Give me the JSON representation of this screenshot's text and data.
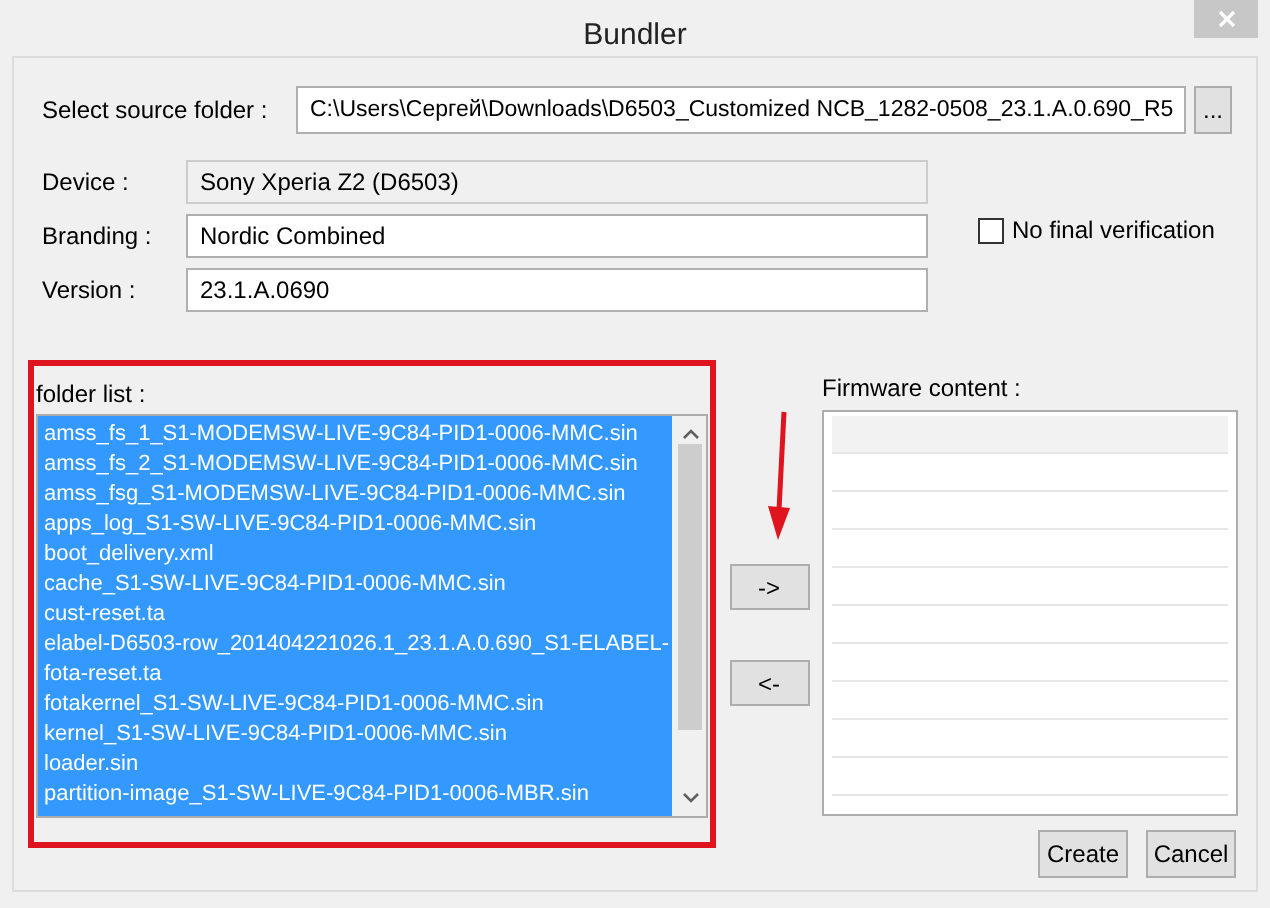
{
  "window": {
    "title": "Bundler"
  },
  "source_folder": {
    "label": "Select source folder :",
    "value": "C:\\Users\\Сергей\\Downloads\\D6503_Customized NCB_1282-0508_23.1.A.0.690_R5",
    "browse_button": "..."
  },
  "fields": [
    {
      "label": "Device :",
      "value": "Sony Xperia Z2 (D6503)",
      "disabled": true
    },
    {
      "label": "Branding :",
      "value": "Nordic Combined",
      "disabled": false
    },
    {
      "label": "Version :",
      "value": "23.1.A.0690",
      "disabled": false
    }
  ],
  "no_final_verification": {
    "label": "No final verification",
    "checked": false
  },
  "folder_list": {
    "label": "folder list :",
    "items": [
      {
        "text": "amss_fs_1_S1-MODEMSW-LIVE-9C84-PID1-0006-MMC.sin",
        "selected": true
      },
      {
        "text": "amss_fs_2_S1-MODEMSW-LIVE-9C84-PID1-0006-MMC.sin",
        "selected": true
      },
      {
        "text": "amss_fsg_S1-MODEMSW-LIVE-9C84-PID1-0006-MMC.sin",
        "selected": true
      },
      {
        "text": "apps_log_S1-SW-LIVE-9C84-PID1-0006-MMC.sin",
        "selected": true
      },
      {
        "text": "boot_delivery.xml",
        "selected": true
      },
      {
        "text": "cache_S1-SW-LIVE-9C84-PID1-0006-MMC.sin",
        "selected": true
      },
      {
        "text": "cust-reset.ta",
        "selected": true
      },
      {
        "text": "elabel-D6503-row_201404221026.1_23.1.A.0.690_S1-ELABEL-",
        "selected": true
      },
      {
        "text": "fota-reset.ta",
        "selected": true
      },
      {
        "text": "fotakernel_S1-SW-LIVE-9C84-PID1-0006-MMC.sin",
        "selected": true
      },
      {
        "text": "kernel_S1-SW-LIVE-9C84-PID1-0006-MMC.sin",
        "selected": true
      },
      {
        "text": "loader.sin",
        "selected": true
      },
      {
        "text": "partition-image_S1-SW-LIVE-9C84-PID1-0006-MBR.sin",
        "selected": true
      }
    ]
  },
  "move_buttons": [
    "->",
    "<-"
  ],
  "firmware_content": {
    "label": "Firmware content :"
  },
  "buttons": [
    "Create",
    "Cancel"
  ]
}
